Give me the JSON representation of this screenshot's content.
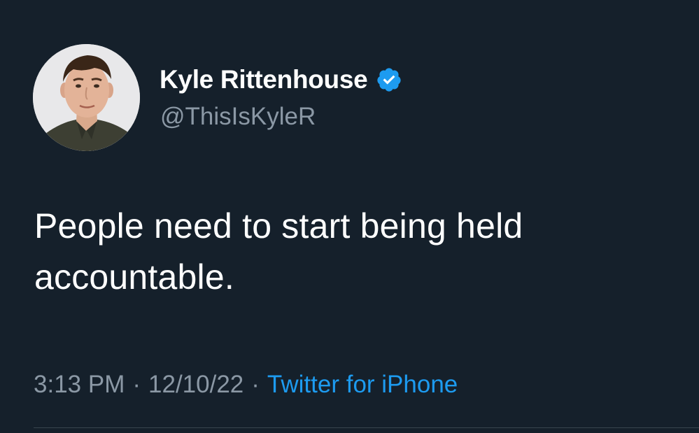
{
  "tweet": {
    "display_name": "Kyle Rittenhouse",
    "handle": "@ThisIsKyleR",
    "verified_icon": "verified-badge-icon",
    "text": "People need to start being held accountable.",
    "time": "3:13 PM",
    "separator": "·",
    "date": "12/10/22",
    "source": "Twitter for iPhone"
  },
  "colors": {
    "background": "#15202b",
    "text_primary": "#ffffff",
    "text_secondary": "#8b98a5",
    "accent": "#1d9bf0",
    "divider": "#38444d"
  }
}
